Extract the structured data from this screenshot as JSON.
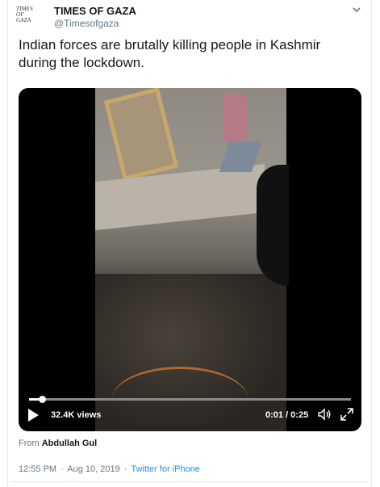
{
  "account": {
    "avatar_lines": [
      "TIMES",
      "OF",
      "GAZA"
    ],
    "name": "TIMES OF GAZA",
    "handle": "@Timesofgaza"
  },
  "tweet": {
    "text": "Indian forces are brutally killing people in Kashmir during the lockdown."
  },
  "video": {
    "views": "32.4K views",
    "time": "0:01 / 0:25",
    "progress_fraction": 0.04
  },
  "attribution": {
    "prefix": "From",
    "name": "Abdullah Gul"
  },
  "meta": {
    "time": "12:55 PM",
    "separator": "·",
    "date": "Aug 10, 2019",
    "app": "Twitter for iPhone"
  },
  "icons": {
    "menu": "chevron-down-icon",
    "play": "play-icon",
    "volume": "volume-icon",
    "fullscreen": "fullscreen-icon"
  },
  "colors": {
    "link": "#1b95e0",
    "secondary_text": "#657786",
    "border": "#e1e8ed"
  }
}
